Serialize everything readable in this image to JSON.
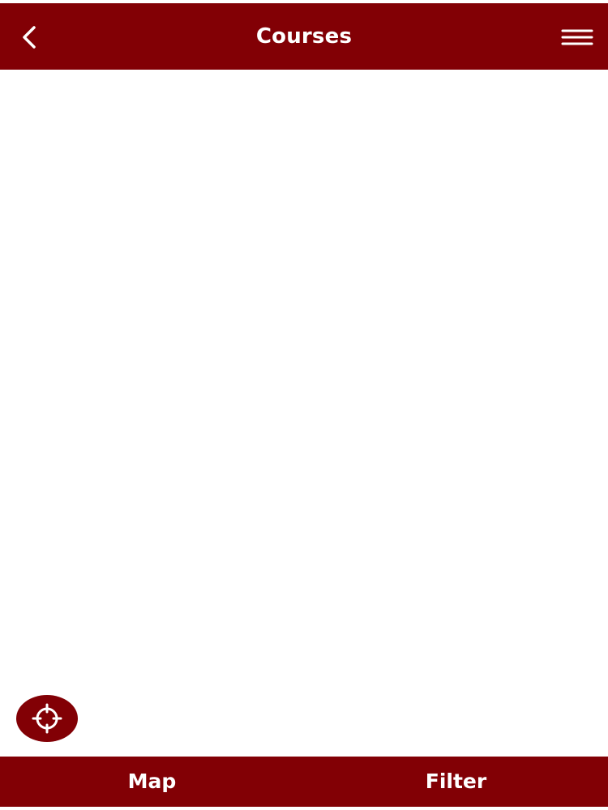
{
  "header": {
    "title": "Courses",
    "back_icon": "chevron-left-icon",
    "menu_icon": "hamburger-menu-icon"
  },
  "map": {
    "locate_icon": "crosshair-locate-icon"
  },
  "bottom_bar": {
    "tabs": [
      {
        "label": "Map"
      },
      {
        "label": "Filter"
      }
    ]
  },
  "colors": {
    "brand": "#820005",
    "on_brand": "#ffffff",
    "background": "#ffffff"
  }
}
